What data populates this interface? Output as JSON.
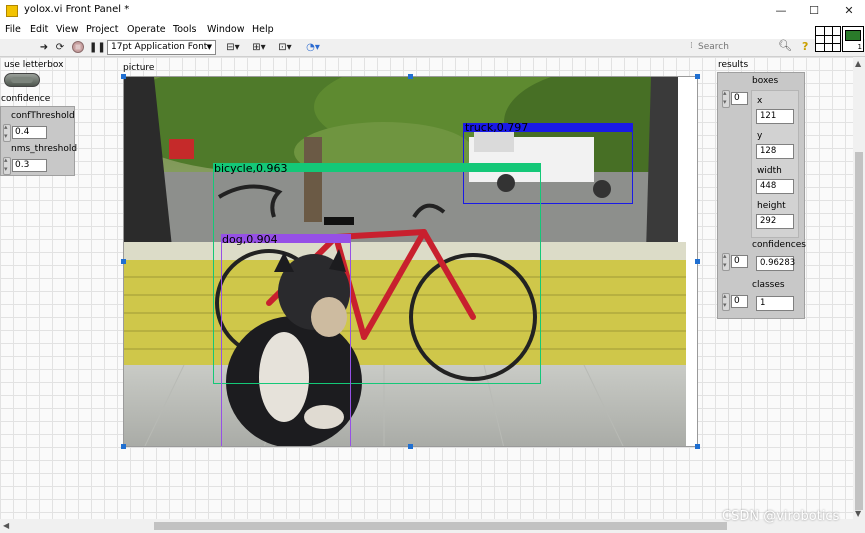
{
  "window": {
    "title": "yolox.vi Front Panel *",
    "minimize": "—",
    "maximize": "☐",
    "close": "✕"
  },
  "menu": [
    "File",
    "Edit",
    "View",
    "Project",
    "Operate",
    "Tools",
    "Window",
    "Help"
  ],
  "toolbar": {
    "font_select": "17pt Application Font",
    "search_placeholder": "Search",
    "search_icon": "magnifier-icon",
    "help_icon": "?",
    "icon_number": "1"
  },
  "controls": {
    "use_letterbox_label": "use letterbox",
    "confidence_label": "confidence",
    "conf_threshold_label": "confThreshold",
    "conf_threshold_value": "0.4",
    "nms_threshold_label": "nms_threshold",
    "nms_threshold_value": "0.3"
  },
  "picture": {
    "label": "picture",
    "detections": [
      {
        "label": "truck,0.797",
        "color": "#1a1ae6"
      },
      {
        "label": "bicycle,0.963",
        "color": "#14c878"
      },
      {
        "label": "dog,0.904",
        "color": "#9650e6"
      }
    ]
  },
  "results": {
    "label": "results",
    "boxes_label": "boxes",
    "boxes_index": "0",
    "x_label": "x",
    "x_value": "121",
    "y_label": "y",
    "y_value": "128",
    "width_label": "width",
    "width_value": "448",
    "height_label": "height",
    "height_value": "292",
    "confidences_label": "confidences",
    "confidences_index": "0",
    "confidences_value": "0.96283",
    "classes_label": "classes",
    "classes_index": "0",
    "classes_value": "1"
  },
  "watermark": "CSDN @virobotics"
}
